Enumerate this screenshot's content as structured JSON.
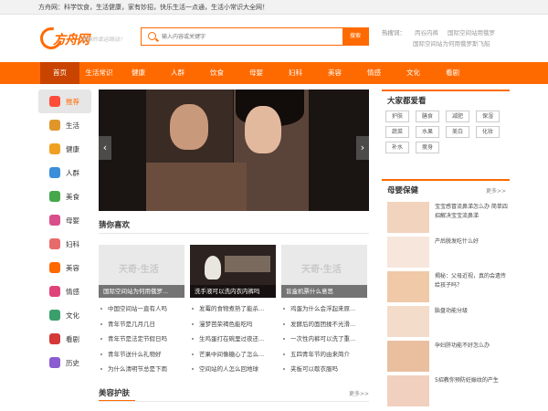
{
  "topbar": {
    "text": "方舟网：科学饮食，生活健康，家有妙招，快乐生活一点通，生活小常识大全网！"
  },
  "logo": {
    "text": "方舟网",
    "slogan": "青春的幸运跳动！"
  },
  "search": {
    "placeholder": "输入内容或关键字",
    "button": "搜索"
  },
  "hot": {
    "label": "热搜词：",
    "words": [
      "丙谷内裤",
      "国际空间站用俄罗",
      "国际空间站为何用俄罗斯飞船"
    ]
  },
  "nav": {
    "items": [
      "首页",
      "生活常识",
      "健康",
      "人群",
      "饮食",
      "母婴",
      "妇科",
      "美容",
      "情感",
      "文化",
      "看剧"
    ]
  },
  "left": {
    "items": [
      "推荐",
      "生活",
      "健康",
      "人群",
      "美食",
      "母婴",
      "妇科",
      "美容",
      "情感",
      "文化",
      "看剧",
      "历史"
    ]
  },
  "colors": {
    "accent": "#ff6a00",
    "nav_active": "#c94400",
    "left_icons": [
      "#ff4d3a",
      "#e0962a",
      "#f0a020",
      "#3b8fd9",
      "#44a84a",
      "#d94f8a",
      "#e86b6b",
      "#ff6a00",
      "#e0437a",
      "#3a9f6a",
      "#d43838",
      "#8a5cd1"
    ]
  },
  "banner": {
    "prev": "‹",
    "next": "›"
  },
  "guess": {
    "title": "猜你喜欢",
    "cards": [
      {
        "watermark": "天奇·生活",
        "caption": "国际空间站为何用俄罗..."
      },
      {
        "watermark": "",
        "caption": "洗手液可以洗内衣内裤吗"
      },
      {
        "watermark": "天奇·生活",
        "caption": "盲盒机票什么意思"
      }
    ],
    "columns": [
      [
        "中国空间站一直有人吗",
        "青年节是几月几日",
        "青年节是法定节假日吗",
        "青年节送什么礼物好",
        "为什么清明节总是下雨"
      ],
      [
        "发霉的食物煮熟了能杀...",
        "漫梦芭荣褐色能吃吗",
        "生鸡蛋打在碗里过夜还...",
        "芒果中间像糖心了怎么...",
        "空间站的人怎么回地球"
      ],
      [
        "鸡蛋为什么会浮起来原...",
        "发酵后的面团揉不光滑...",
        "一次性内裤可以洗了重...",
        "五四青年节的由来简介",
        "夹板可以歇衣服吗"
      ]
    ]
  },
  "beauty": {
    "title": "美容护肤",
    "more": "更多>>"
  },
  "right": {
    "love_title": "大家都爱看",
    "tags": [
      "护肤",
      "膳食",
      "减肥",
      "保湿",
      "蔬菜",
      "水果",
      "美白",
      "化妆",
      "补水",
      "瘦身"
    ],
    "baby_title": "母婴保健",
    "baby_more": "更多>>",
    "baby_items": [
      "宝宝感冒流鼻涕怎么办 简单四招解决宝宝流鼻涕",
      "产后脱发吃什么好",
      "揭秘：父母近视，真的会遗传给孩子吗？",
      "胎盘功能分级",
      "孕妇肝功能不好怎么办",
      "5招教你预防妊娠纹的产生"
    ]
  }
}
